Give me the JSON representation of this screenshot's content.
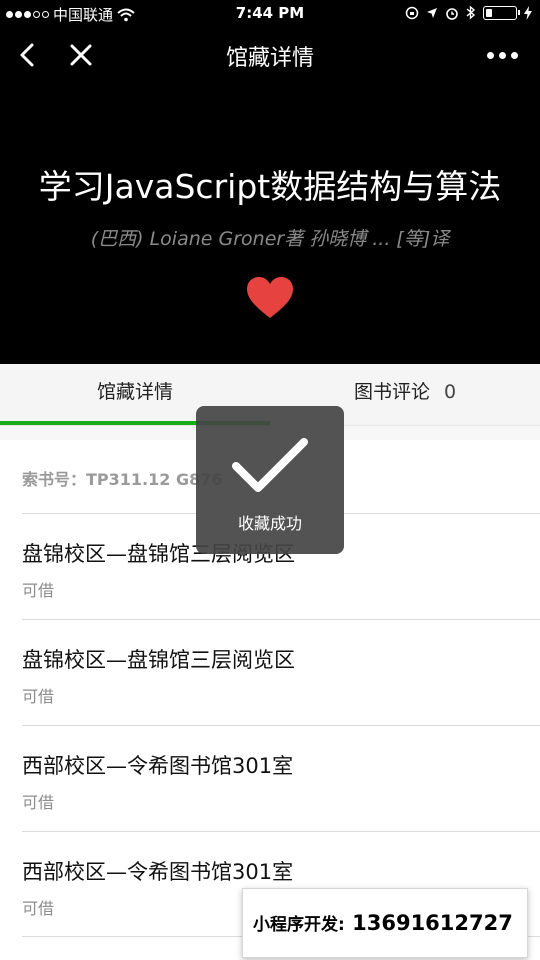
{
  "status_bar": {
    "carrier": "中国联通",
    "time": "7:44 PM"
  },
  "nav": {
    "title": "馆藏详情"
  },
  "book": {
    "title": "学习JavaScript数据结构与算法",
    "authors": "(巴西) Loiane Groner著 孙晓博 ... [等]译"
  },
  "tabs": {
    "info_label": "馆藏详情",
    "reviews_label": "图书评论",
    "reviews_count": "0"
  },
  "call_number": {
    "label": "索书号：",
    "value": "TP311.12 G876"
  },
  "holdings": [
    {
      "location": "盘锦校区—盘锦馆三层阅览区",
      "status": "可借"
    },
    {
      "location": "盘锦校区—盘锦馆三层阅览区",
      "status": "可借"
    },
    {
      "location": "西部校区—令希图书馆301室",
      "status": "可借"
    },
    {
      "location": "西部校区—令希图书馆301室",
      "status": "可借"
    }
  ],
  "toast": {
    "message": "收藏成功"
  },
  "promo": {
    "label": "小程序开发:",
    "phone": "13691612727"
  },
  "colors": {
    "accent_green": "#1aad19",
    "heart_red": "#e64340",
    "header_bg": "#000000"
  },
  "icons": [
    "back-icon",
    "close-icon",
    "more-icon",
    "heart-icon",
    "checkmark-icon",
    "wifi-icon",
    "battery-icon"
  ]
}
